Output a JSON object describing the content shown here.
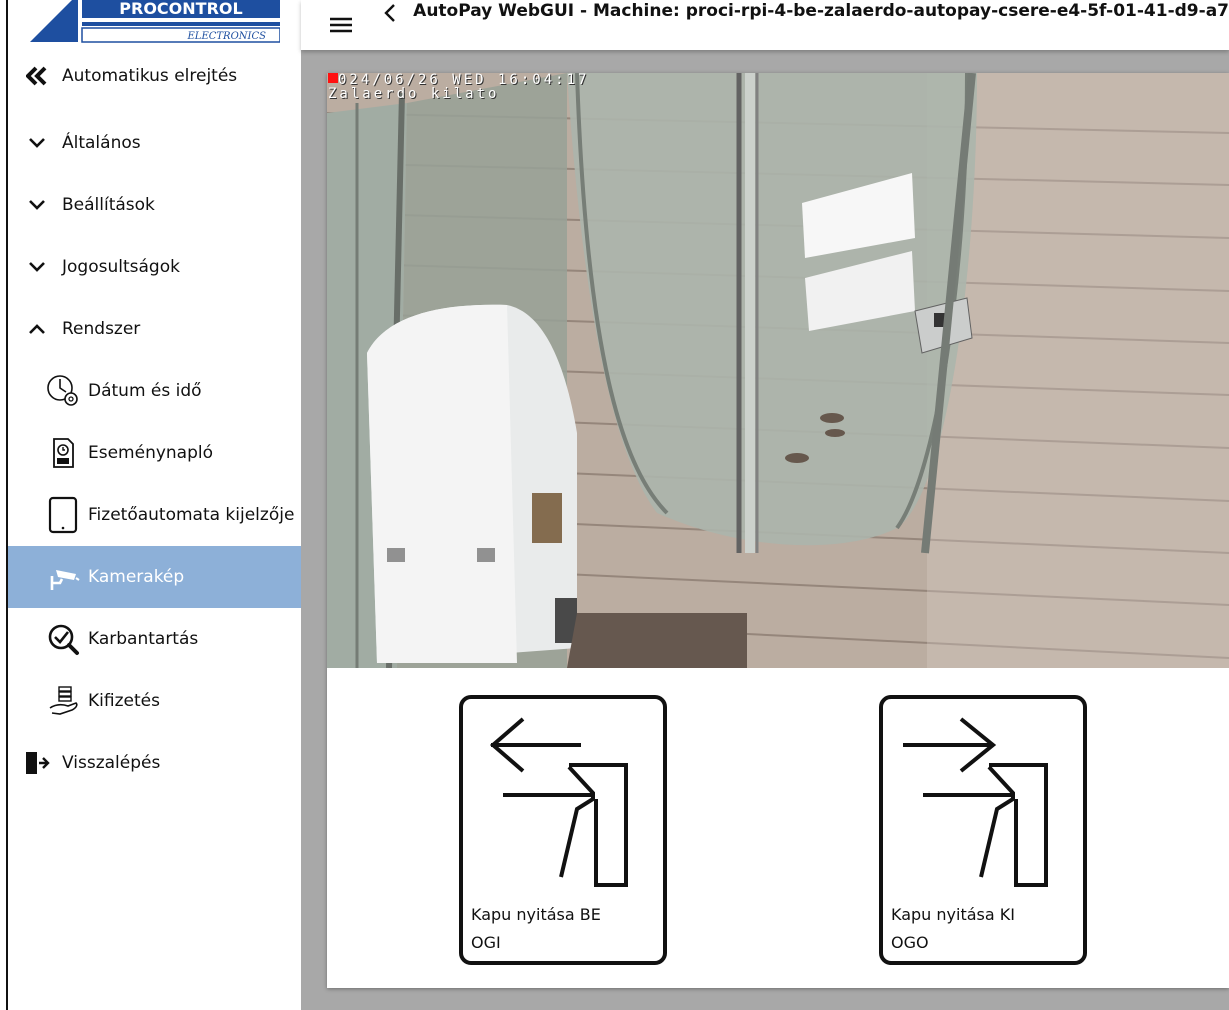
{
  "logo": {
    "brand": "PROCONTROL",
    "sub": "ELECTRONICS"
  },
  "sidebar": {
    "items": [
      {
        "name": "auto-hide",
        "label": "Automatikus elrejtés",
        "icon": "double-chevron-left-icon"
      },
      {
        "name": "general",
        "label": "Általános",
        "icon": "chevron-down-icon"
      },
      {
        "name": "settings",
        "label": "Beállítások",
        "icon": "chevron-down-icon"
      },
      {
        "name": "permissions",
        "label": "Jogosultságok",
        "icon": "chevron-down-icon"
      },
      {
        "name": "system",
        "label": "Rendszer",
        "icon": "chevron-up-icon"
      },
      {
        "name": "date-time",
        "label": "Dátum és idő",
        "icon": "clock-gear-icon"
      },
      {
        "name": "event-log",
        "label": "Eseménynapló",
        "icon": "log-file-icon"
      },
      {
        "name": "payment-display",
        "label": "Fizetőautomata kijelzője",
        "icon": "tablet-icon"
      },
      {
        "name": "camera-image",
        "label": "Kamerakép",
        "icon": "security-camera-icon",
        "active": true
      },
      {
        "name": "maintenance",
        "label": "Karbantartás",
        "icon": "wrench-check-icon"
      },
      {
        "name": "payout",
        "label": "Kifizetés",
        "icon": "hand-money-icon"
      },
      {
        "name": "logout",
        "label": "Visszalépés",
        "icon": "exit-door-icon"
      }
    ]
  },
  "topbar": {
    "title": "AutoPay WebGUI - Machine: proci-rpi-4-be-zalaerdo-autopay-csere-e4-5f-01-41-d9-a7"
  },
  "camera": {
    "osd_line1": "024/06/26 WED 16:04:17",
    "osd_line2": "Zalaerdo kilato"
  },
  "buttons": {
    "open_in_line1": "Kapu nyitása BE",
    "open_in_line2": "OGI",
    "open_out_line1": "Kapu nyitása KI",
    "open_out_line2": "OGO"
  },
  "colors": {
    "active_bg": "#8db0d8",
    "main_bg": "#a8a8a8"
  }
}
